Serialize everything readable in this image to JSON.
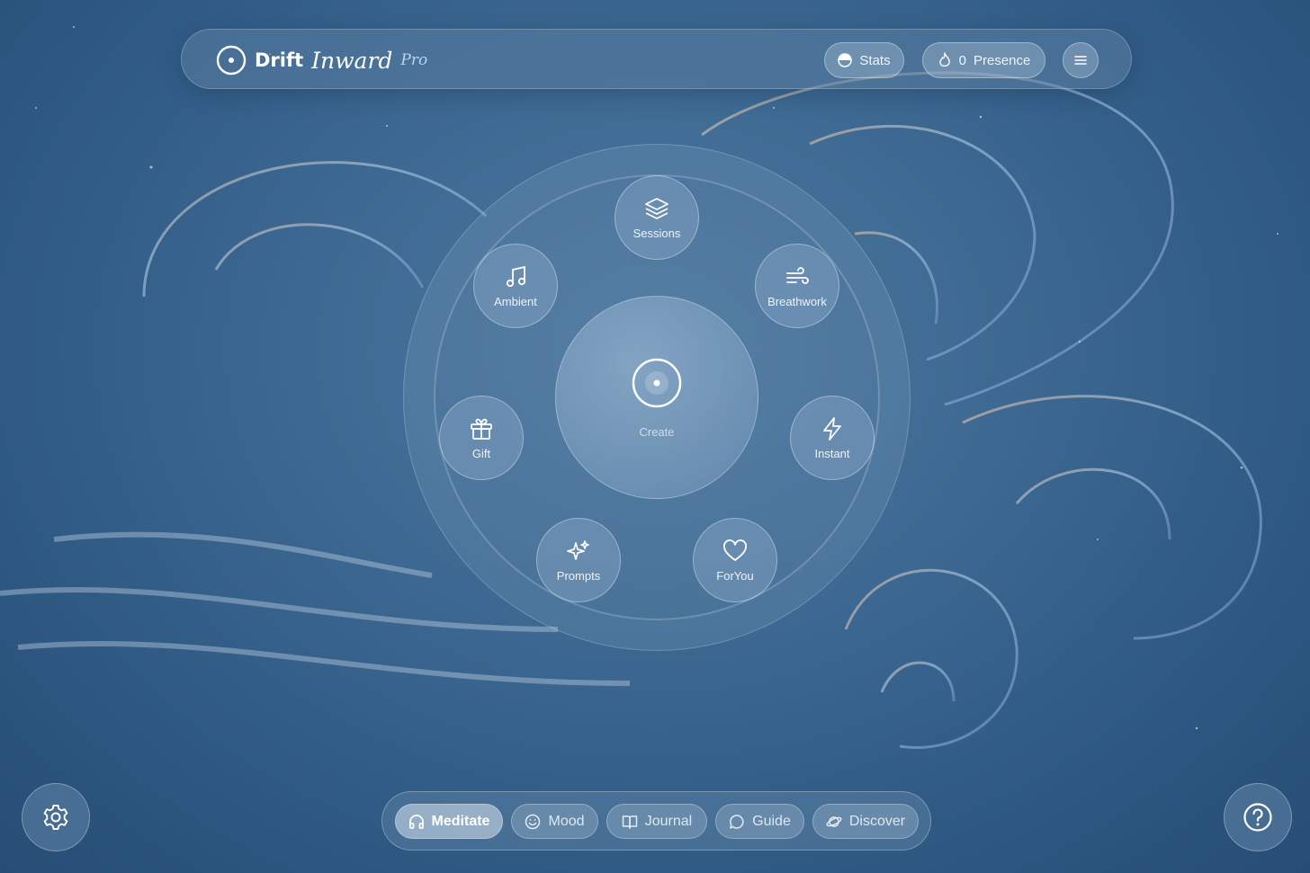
{
  "app": {
    "brand_name": "Drift",
    "brand_word": "Inward",
    "brand_tier": "Pro",
    "logo_icon": "circle-dot-icon"
  },
  "header": {
    "stats_label": "Stats",
    "stats_icon": "half-circle-icon",
    "presence_count": "0",
    "presence_label": "Presence",
    "presence_icon": "flame-icon",
    "menu_icon": "hamburger-menu-icon"
  },
  "dial": {
    "center_label": "Create",
    "center_icon": "circle-dot-icon",
    "items": [
      {
        "label": "Sessions",
        "icon": "layers-icon"
      },
      {
        "label": "Breathwork",
        "icon": "wind-icon"
      },
      {
        "label": "Instant",
        "icon": "lightning-icon"
      },
      {
        "label": "ForYou",
        "icon": "heart-icon"
      },
      {
        "label": "Prompts",
        "icon": "sparkles-icon"
      },
      {
        "label": "Gift",
        "icon": "gift-icon"
      },
      {
        "label": "Ambient",
        "icon": "music-note-icon"
      }
    ]
  },
  "bottom_nav": {
    "tabs": [
      {
        "label": "Meditate",
        "icon": "headphones-icon",
        "active": true
      },
      {
        "label": "Mood",
        "icon": "smiley-icon",
        "active": false
      },
      {
        "label": "Journal",
        "icon": "book-icon",
        "active": false
      },
      {
        "label": "Guide",
        "icon": "chat-bubble-icon",
        "active": false
      },
      {
        "label": "Discover",
        "icon": "planet-icon",
        "active": false
      }
    ]
  },
  "corners": {
    "settings_icon": "gear-icon",
    "help_icon": "question-circle-icon"
  },
  "colors": {
    "background": "#3e6a93",
    "accent_text": "#b9d4f3",
    "text": "#f2f6fb"
  }
}
